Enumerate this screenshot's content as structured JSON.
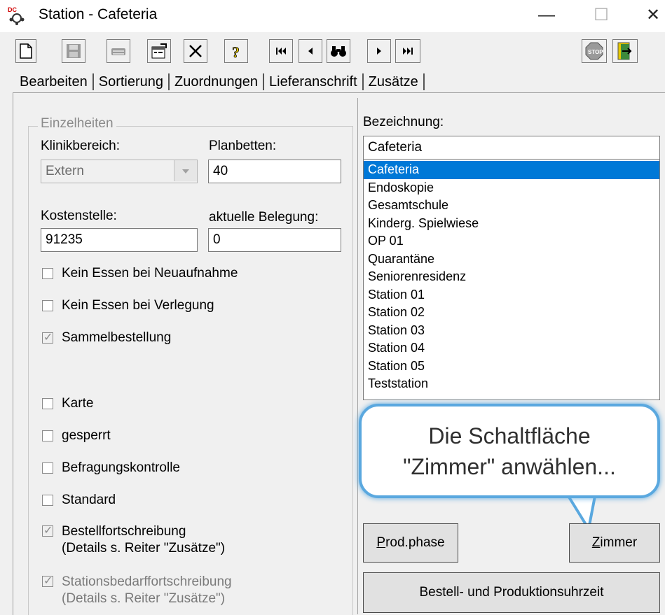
{
  "window": {
    "title": "Station - Cafeteria",
    "minimize": "—",
    "maximize": "☐",
    "close": "✕"
  },
  "toolbar": {
    "icons": [
      "new-icon",
      "save-icon",
      "print-icon",
      "properties-icon",
      "delete-icon",
      "help-icon",
      "first-icon",
      "previous-icon",
      "find-icon",
      "next-icon",
      "last-icon",
      "stop-icon",
      "exit-icon"
    ]
  },
  "tabs": [
    "Bearbeiten",
    "Sortierung",
    "Zuordnungen",
    "Lieferanschrift",
    "Zusätze"
  ],
  "details": {
    "legend": "Einzelheiten",
    "klinikbereich_label": "Klinikbereich:",
    "klinikbereich_value": "Extern",
    "planbetten_label": "Planbetten:",
    "planbetten_value": "40",
    "kostenstelle_label": "Kostenstelle:",
    "kostenstelle_value": "91235",
    "belegung_label": "aktuelle Belegung:",
    "belegung_value": "0"
  },
  "checkboxes": {
    "kein_essen_neu": "Kein Essen bei Neuaufnahme",
    "kein_essen_verlegung": "Kein Essen bei Verlegung",
    "sammel": "Sammelbestellung",
    "karte": "Karte",
    "gesperrt": "gesperrt",
    "befragung": "Befragungskontrolle",
    "standard": "Standard",
    "bestell_line1": "Bestellfortschreibung",
    "bestell_line2": "(Details s. Reiter \"Zusätze\")",
    "stations_line1": "Stationsbedarffortschreibung",
    "stations_line2": "(Details s. Reiter \"Zusätze\")"
  },
  "bezeichnung": {
    "label": "Bezeichnung:",
    "value": "Cafeteria",
    "items": [
      "Cafeteria",
      "Endoskopie",
      "Gesamtschule",
      "Kinderg. Spielwiese",
      "OP 01",
      "Quarantäne",
      "Seniorenresidenz",
      "Station 01",
      "Station 02",
      "Station 03",
      "Station 04",
      "Station 05",
      "Teststation"
    ],
    "selected": "Cafeteria"
  },
  "callout": {
    "line1": "Die Schaltfläche",
    "line2": "\"Zimmer\" anwählen..."
  },
  "buttons": {
    "prodphase_underlined": "P",
    "prodphase_rest": "rod.phase",
    "zimmer_underlined": "Z",
    "zimmer_rest": "immer",
    "bestell_produktion": "Bestell- und Produktionsuhrzeit"
  },
  "colors": {
    "selection": "#0078d7",
    "callout_border": "#5aa8df"
  }
}
